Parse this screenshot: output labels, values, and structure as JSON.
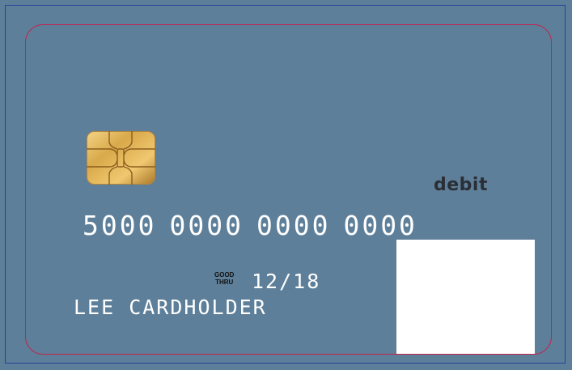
{
  "card": {
    "brand_label": "debit",
    "number_groups": [
      "5000",
      "0000",
      "0000",
      "0000"
    ],
    "good_thru_line1": "GOOD",
    "good_thru_line2": "THRU",
    "expiry": "12/18",
    "cardholder": "LEE CARDHOLDER"
  },
  "colors": {
    "card_background": "#5e7f99",
    "bleed_line": "#2b3f9a",
    "safe_line": "#c0234e",
    "text_primary": "#ffffff",
    "text_dark": "#2a2f36",
    "chip_gold": "#d9a94a"
  },
  "icons": {
    "chip": "emv-chip-icon"
  }
}
